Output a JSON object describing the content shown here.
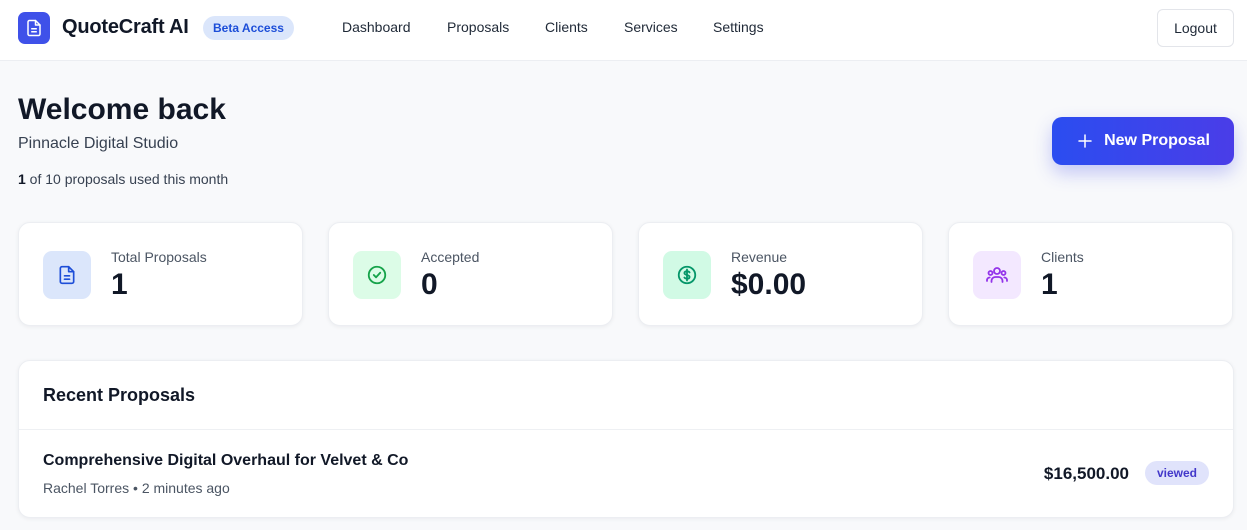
{
  "app": {
    "name": "QuoteCraft AI",
    "badge": "Beta Access",
    "logo_icon": "document-icon",
    "accent": "#3f51e9"
  },
  "nav": {
    "items": [
      {
        "label": "Dashboard"
      },
      {
        "label": "Proposals"
      },
      {
        "label": "Clients"
      },
      {
        "label": "Services"
      },
      {
        "label": "Settings"
      }
    ],
    "logout_label": "Logout"
  },
  "welcome": {
    "title": "Welcome back",
    "organization": "Pinnacle Digital Studio",
    "usage_count": "1",
    "usage_text": " of 10 proposals used this month",
    "new_proposal_label": "New Proposal"
  },
  "stats": [
    {
      "label": "Total Proposals",
      "value": "1",
      "icon": "document-icon",
      "bg": "#dbe6fb",
      "fg": "#1d4ed8"
    },
    {
      "label": "Accepted",
      "value": "0",
      "icon": "check-circle-icon",
      "bg": "#dcfce7",
      "fg": "#16a34a"
    },
    {
      "label": "Revenue",
      "value": "$0.00",
      "icon": "dollar-circle-icon",
      "bg": "#d1fae5",
      "fg": "#059669"
    },
    {
      "label": "Clients",
      "value": "1",
      "icon": "users-icon",
      "bg": "#f3e8ff",
      "fg": "#9333ea"
    }
  ],
  "recent": {
    "title": "Recent Proposals",
    "items": [
      {
        "title": "Comprehensive Digital Overhaul for Velvet & Co",
        "client": "Rachel Torres",
        "time": "2 minutes ago",
        "amount": "$16,500.00",
        "status": "viewed"
      }
    ]
  }
}
